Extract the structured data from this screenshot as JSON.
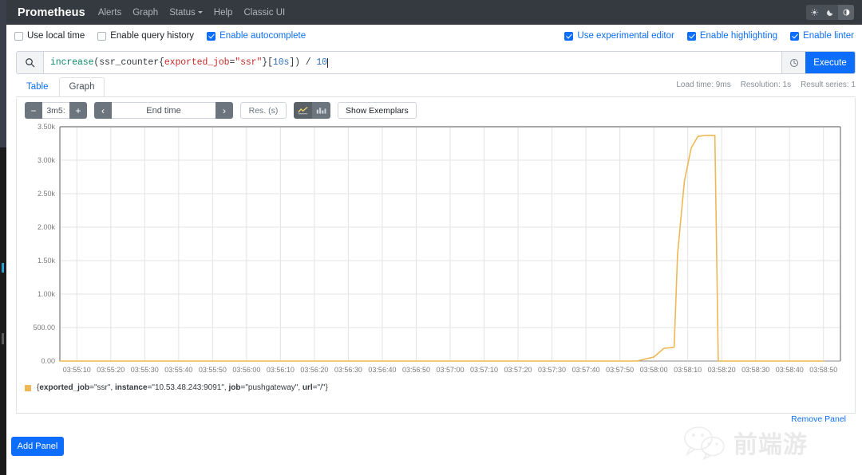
{
  "navbar": {
    "brand": "Prometheus",
    "links": [
      {
        "label": "Alerts",
        "caret": false
      },
      {
        "label": "Graph",
        "caret": false
      },
      {
        "label": "Status",
        "caret": true
      },
      {
        "label": "Help",
        "caret": false
      },
      {
        "label": "Classic UI",
        "caret": false
      }
    ],
    "theme": {
      "light_icon": "sun-icon",
      "dark_icon": "moon-icon",
      "auto_icon": "half-circle-icon",
      "active": "auto"
    }
  },
  "options": {
    "left": [
      {
        "label": "Use local time",
        "checked": false
      },
      {
        "label": "Enable query history",
        "checked": false
      },
      {
        "label": "Enable autocomplete",
        "checked": true
      }
    ],
    "right": [
      {
        "label": "Use experimental editor",
        "checked": true
      },
      {
        "label": "Enable highlighting",
        "checked": true
      },
      {
        "label": "Enable linter",
        "checked": true
      }
    ]
  },
  "query": {
    "search_icon": "search-icon",
    "history_icon": "history-clock-icon",
    "execute_label": "Execute",
    "expression": "increase(ssr_counter{exported_job=\"ssr\"}[10s]) / 10",
    "tokens": [
      {
        "text": "increase",
        "type": "fn"
      },
      {
        "text": "(ssr_counter{",
        "type": "plain"
      },
      {
        "text": "exported_job",
        "type": "label"
      },
      {
        "text": "=",
        "type": "plain"
      },
      {
        "text": "\"ssr\"",
        "type": "str"
      },
      {
        "text": "}[",
        "type": "plain"
      },
      {
        "text": "10s",
        "type": "dur"
      },
      {
        "text": "]) / ",
        "type": "plain"
      },
      {
        "text": "10",
        "type": "num"
      }
    ]
  },
  "tabs": [
    {
      "label": "Table",
      "active": false
    },
    {
      "label": "Graph",
      "active": true
    }
  ],
  "stats": {
    "load_time": "Load time: 9ms",
    "resolution": "Resolution: 1s",
    "result_series": "Result series: 1"
  },
  "graph_controls": {
    "decrease_label": "−",
    "range_value": "3m5:",
    "increase_label": "+",
    "prev_label": "‹",
    "end_time_placeholder": "End time",
    "next_label": "›",
    "resolution_placeholder": "Res. (s)",
    "line_chart_icon": "line-chart-icon",
    "stacked_chart_icon": "stacked-bar-icon",
    "chart_type_selected": "line",
    "exemplars_label": "Show Exemplars"
  },
  "legend": {
    "color": "#edb855",
    "prefix": "{",
    "parts": [
      {
        "key": "exported_job",
        "value": "\"ssr\""
      },
      {
        "key": "instance",
        "value": "\"10.53.48.243:9091\""
      },
      {
        "key": "job",
        "value": "\"pushgateway\""
      },
      {
        "key": "url",
        "value": "\"/\""
      }
    ],
    "full_text": "{exported_job=\"ssr\", instance=\"10.53.48.243:9091\", job=\"pushgateway\", url=\"/\"}"
  },
  "footer": {
    "remove_panel": "Remove Panel",
    "add_panel": "Add Panel"
  },
  "watermark": {
    "text": "前端游",
    "logo_icon": "wechat-logo-icon"
  },
  "chart_data": {
    "type": "line",
    "title": "",
    "xlabel": "",
    "ylabel": "",
    "grid": true,
    "legend_position": "bottom-left",
    "line_color": "#edb855",
    "ylim": [
      0,
      3500
    ],
    "ytick_values": [
      0,
      500,
      1000,
      1500,
      2000,
      2500,
      3000,
      3500
    ],
    "ytick_labels": [
      "0.00",
      "500.00",
      "1.00k",
      "1.50k",
      "2.00k",
      "2.50k",
      "3.00k",
      "3.50k"
    ],
    "xtick_labels": [
      "03:55:10",
      "03:55:20",
      "03:55:30",
      "03:55:40",
      "03:55:50",
      "03:56:00",
      "03:56:10",
      "03:56:20",
      "03:56:30",
      "03:56:40",
      "03:56:50",
      "03:57:00",
      "03:57:10",
      "03:57:20",
      "03:57:30",
      "03:57:40",
      "03:57:50",
      "03:58:00",
      "03:58:10",
      "03:58:20",
      "03:58:30",
      "03:58:40",
      "03:58:50"
    ],
    "series": [
      {
        "name": "{exported_job=\"ssr\", instance=\"10.53.48.243:9091\", job=\"pushgateway\", url=\"/\"}",
        "color": "#edb855",
        "points": [
          {
            "t": "03:55:05",
            "v": 0
          },
          {
            "t": "03:57:50",
            "v": 0
          },
          {
            "t": "03:57:55",
            "v": 0
          },
          {
            "t": "03:58:00",
            "v": 60
          },
          {
            "t": "03:58:03",
            "v": 190
          },
          {
            "t": "03:58:06",
            "v": 205
          },
          {
            "t": "03:58:07",
            "v": 1590
          },
          {
            "t": "03:58:09",
            "v": 2680
          },
          {
            "t": "03:58:11",
            "v": 3180
          },
          {
            "t": "03:58:13",
            "v": 3355
          },
          {
            "t": "03:58:15",
            "v": 3370
          },
          {
            "t": "03:58:18",
            "v": 3370
          },
          {
            "t": "03:58:19",
            "v": 0
          },
          {
            "t": "03:58:50",
            "v": 0
          }
        ]
      }
    ]
  }
}
